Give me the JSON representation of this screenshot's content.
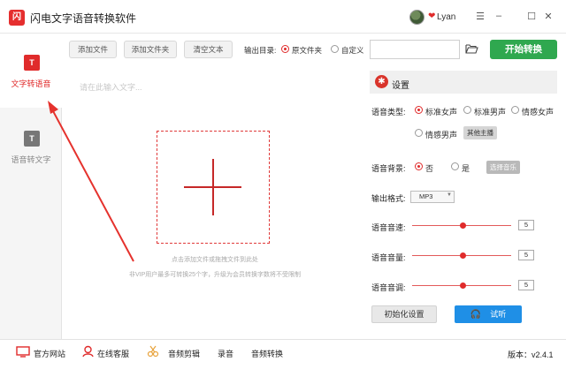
{
  "app": {
    "logo_text": "闪",
    "title": "闪电文字语音转换软件",
    "username": "Lyan",
    "heart": "❤"
  },
  "window_controls": [
    "☰",
    "–",
    "☐",
    "✕"
  ],
  "sidebar": {
    "items": [
      {
        "label": "文字转语音",
        "icon": "text-to-speech-icon",
        "active": true
      },
      {
        "label": "语音转文字",
        "icon": "speech-to-text-icon",
        "active": false
      }
    ]
  },
  "toolbar": {
    "add_file": "添加文件",
    "add_folder": "添加文件夹",
    "clear_text": "清空文本",
    "output_dir_label": "输出目录:",
    "option_original": "原文件夹",
    "option_custom": "自定义",
    "start": "开始转换"
  },
  "editor": {
    "placeholder": "请在此输入文字...",
    "hint_drop": "点击添加文件或拖拽文件到此处",
    "hint_vip": "非VIP用户最多可转换25个字，升级为会员转换字数将不受限制"
  },
  "settings": {
    "title": "设置",
    "voice_type_label": "语音类型:",
    "voices": [
      "标准女声",
      "标准男声",
      "情感女声",
      "情感男声"
    ],
    "selected_voice": "标准女声",
    "other_anchor": "其他主播",
    "bg_label": "语音背景:",
    "bg_no": "否",
    "bg_yes": "是",
    "choose_music": "选择音乐",
    "format_label": "输出格式:",
    "format_value": "MP3",
    "speed_label": "语音音速:",
    "speed_value": "5",
    "volume_label": "语音音量:",
    "volume_value": "5",
    "pitch_label": "语音音调:",
    "pitch_value": "5",
    "init_btn": "初始化设置",
    "listen_btn": "试听"
  },
  "bottombar": {
    "website": "官方网站",
    "support": "在线客服",
    "audio_edit": "音频剪辑",
    "record": "录音",
    "audio_convert": "音频转换",
    "version": "版本：v2.4.1"
  },
  "colors": {
    "accent_red": "#e02b2b",
    "start_green": "#2fa84f",
    "listen_blue": "#1f8fe6"
  }
}
